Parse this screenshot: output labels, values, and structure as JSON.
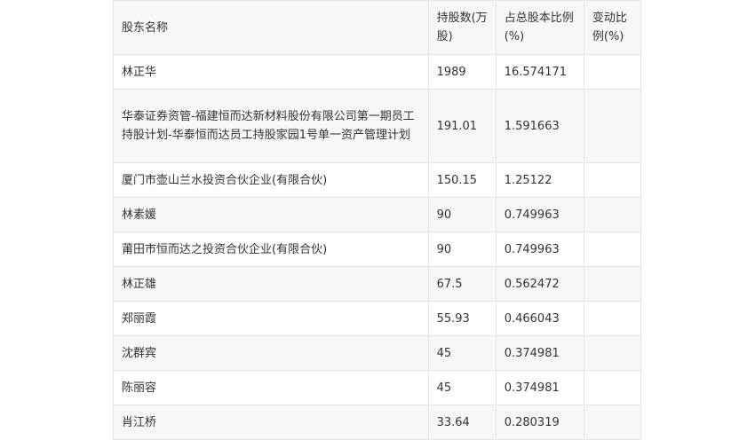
{
  "table": {
    "headers": {
      "name": "股东名称",
      "shares": "持股数(万股)",
      "ratio": "占总股本比例(%)",
      "change": "变动比例(%)"
    },
    "rows": [
      {
        "name": "林正华",
        "shares": "1989",
        "ratio": "16.574171",
        "change": ""
      },
      {
        "name": "华泰证券资管-福建恒而达新材料股份有限公司第一期员工持股计划-华泰恒而达员工持股家园1号单一资产管理计划",
        "shares": "191.01",
        "ratio": "1.591663",
        "change": ""
      },
      {
        "name": "厦门市壶山兰水投资合伙企业(有限合伙)",
        "shares": "150.15",
        "ratio": "1.25122",
        "change": ""
      },
      {
        "name": "林素媛",
        "shares": "90",
        "ratio": "0.749963",
        "change": ""
      },
      {
        "name": "莆田市恒而达之投资合伙企业(有限合伙)",
        "shares": "90",
        "ratio": "0.749963",
        "change": ""
      },
      {
        "name": "林正雄",
        "shares": "67.5",
        "ratio": "0.562472",
        "change": ""
      },
      {
        "name": "郑丽霞",
        "shares": "55.93",
        "ratio": "0.466043",
        "change": ""
      },
      {
        "name": "沈群宾",
        "shares": "45",
        "ratio": "0.374981",
        "change": ""
      },
      {
        "name": "陈丽容",
        "shares": "45",
        "ratio": "0.374981",
        "change": ""
      },
      {
        "name": "肖江桥",
        "shares": "33.64",
        "ratio": "0.280319",
        "change": ""
      }
    ]
  }
}
